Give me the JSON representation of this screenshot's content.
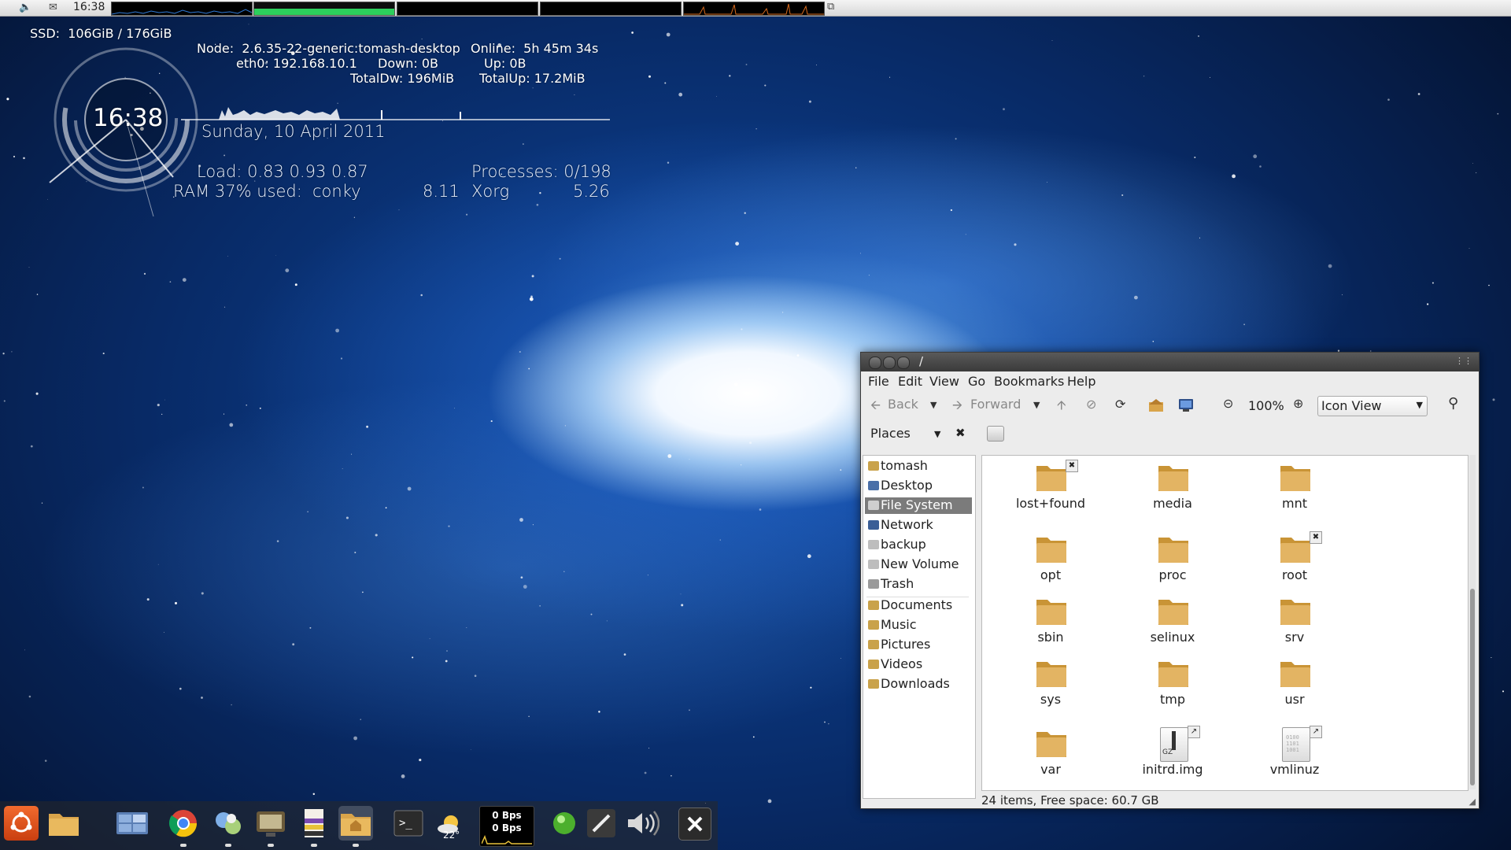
{
  "top_panel": {
    "clock": "16:38",
    "volume_icon": "speaker-icon",
    "mail_icon": "mail-icon"
  },
  "conky": {
    "ssd": "SSD:  106GiB / 176GiB",
    "node": "Node:  2.6.35-22-generic:tomash-desktop",
    "online": "Online:  5h 45m 34s",
    "eth0": "eth0: 192.168.10.1",
    "down": "Down: 0B",
    "up": "Up: 0B",
    "totaldw": "TotalDw: 196MiB",
    "totalup": "TotalUp: 17.2MiB",
    "clock": "16:38",
    "date": "Sunday, 10 April 2011",
    "load": "Load: 0.83 0.93 0.87",
    "processes": "Processes: 0/198",
    "ram": "RAM 37% used:",
    "proc1_name": "conky",
    "proc1_val": "8.11",
    "proc2_name": "Xorg",
    "proc2_val": "5.26"
  },
  "dock": {
    "net_down": "0 Bps",
    "net_up": "0 Bps",
    "weather_temp": "22°"
  },
  "window": {
    "title": "/",
    "menu": [
      "File",
      "Edit",
      "View",
      "Go",
      "Bookmarks",
      "Help"
    ],
    "toolbar": {
      "back": "Back",
      "forward": "Forward",
      "zoom": "100%",
      "view_mode": "Icon View"
    },
    "places_label": "Places",
    "places": [
      {
        "label": "tomash",
        "icon": "home-folder-icon",
        "color": "#c9a24a"
      },
      {
        "label": "Desktop",
        "icon": "desktop-icon",
        "color": "#4a6fa8"
      },
      {
        "label": "File System",
        "icon": "filesystem-icon",
        "color": "#cfcfcf",
        "selected": true
      },
      {
        "label": "Network",
        "icon": "network-icon",
        "color": "#3a5e96"
      },
      {
        "label": "backup",
        "icon": "drive-icon",
        "color": "#bdbdbd"
      },
      {
        "label": "New Volume",
        "icon": "drive-icon",
        "color": "#bdbdbd"
      },
      {
        "label": "Trash",
        "icon": "trash-icon",
        "color": "#9a9a9a"
      }
    ],
    "bookmarks": [
      {
        "label": "Documents",
        "icon": "documents-folder-icon",
        "color": "#c9a24a"
      },
      {
        "label": "Music",
        "icon": "music-folder-icon",
        "color": "#c9a24a"
      },
      {
        "label": "Pictures",
        "icon": "pictures-folder-icon",
        "color": "#c9a24a"
      },
      {
        "label": "Videos",
        "icon": "videos-folder-icon",
        "color": "#c9a24a"
      },
      {
        "label": "Downloads",
        "icon": "downloads-folder-icon",
        "color": "#c9a24a"
      }
    ],
    "files": [
      {
        "name": "lost+found",
        "type": "folder",
        "emblem": "locked-emblem"
      },
      {
        "name": "media",
        "type": "folder"
      },
      {
        "name": "mnt",
        "type": "folder"
      },
      {
        "name": "opt",
        "type": "folder"
      },
      {
        "name": "proc",
        "type": "folder"
      },
      {
        "name": "root",
        "type": "folder",
        "emblem": "locked-emblem"
      },
      {
        "name": "sbin",
        "type": "folder"
      },
      {
        "name": "selinux",
        "type": "folder"
      },
      {
        "name": "srv",
        "type": "folder"
      },
      {
        "name": "sys",
        "type": "folder"
      },
      {
        "name": "tmp",
        "type": "folder"
      },
      {
        "name": "usr",
        "type": "folder"
      },
      {
        "name": "var",
        "type": "folder"
      },
      {
        "name": "initrd.img",
        "type": "archive",
        "badge": "GZ",
        "emblem": "symlink-emblem"
      },
      {
        "name": "vmlinuz",
        "type": "binary",
        "emblem": "symlink-emblem"
      }
    ],
    "status": "24 items, Free space: 60.7 GB"
  },
  "colors": {
    "folder": "#e3b463",
    "folder_dark": "#c99436",
    "selection": "#7b7b7b",
    "ubuntu_orange": "#dd4814"
  }
}
